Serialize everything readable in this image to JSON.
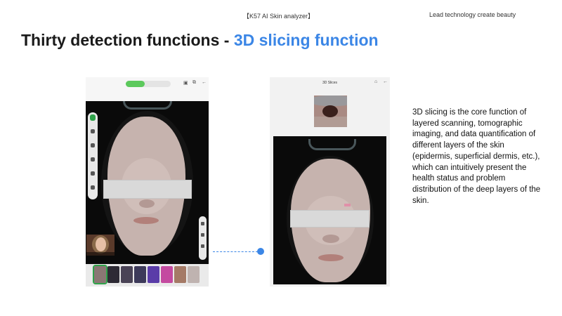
{
  "header": {
    "center": "【K57  AI  Skin analyzer】",
    "right": "Lead technology create beauty"
  },
  "title": {
    "main": "Thirty detection functions - ",
    "accent": "3D slicing function"
  },
  "right_screen": {
    "title": "3D Slices"
  },
  "description": "3D slicing is the core function of layered scanning, tomographic imaging, and data quantification of different layers of the skin (epidermis, superficial dermis, etc.), which can intuitively present the health status and problem distribution of the deep layers of the skin.",
  "colors": {
    "accent": "#3b86e6",
    "active_green": "#2fa34a",
    "toggle_green": "#5cc95c"
  },
  "icons": [
    "save-icon",
    "share-icon",
    "back-arrow-icon",
    "home-icon"
  ]
}
